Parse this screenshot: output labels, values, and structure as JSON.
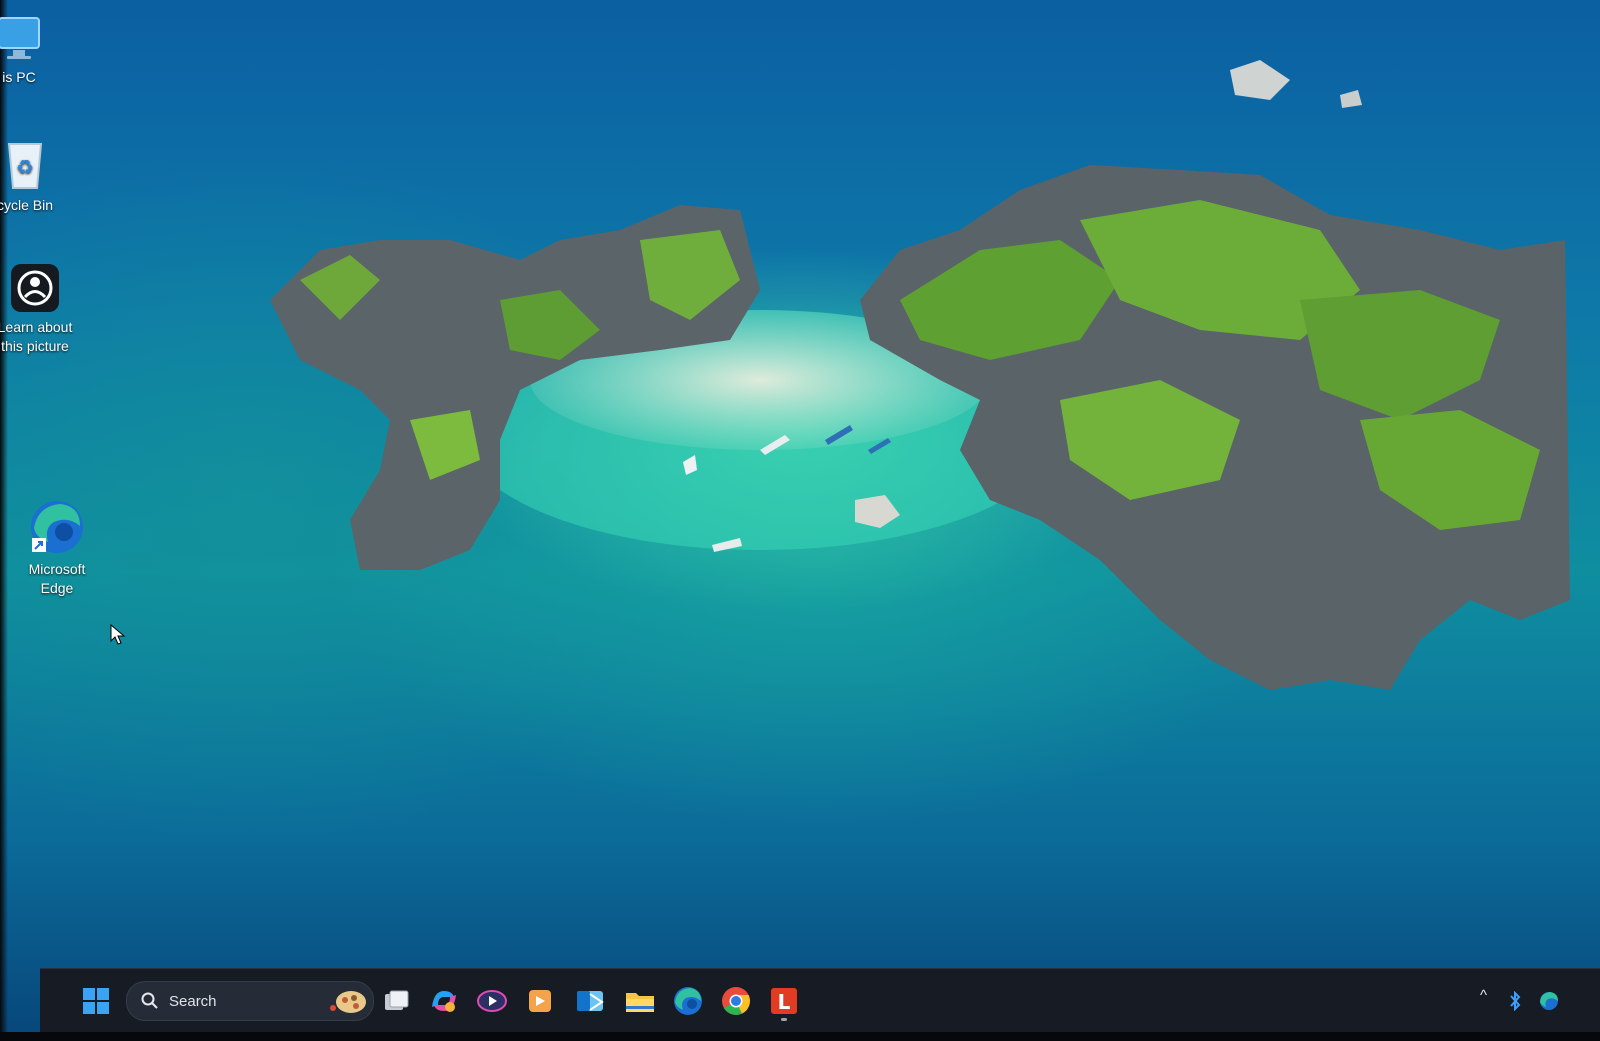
{
  "desktop": {
    "icons": [
      {
        "label": "is PC"
      },
      {
        "label": "cycle Bin"
      },
      {
        "label_line1": "Learn about",
        "label_line2": "this picture"
      },
      {
        "label_line1": "Microsoft",
        "label_line2": "Edge"
      }
    ]
  },
  "taskbar": {
    "search_placeholder": "Search",
    "apps": [
      "Task View",
      "Microsoft 365 Copilot",
      "Media Player",
      "Office",
      "Outlook",
      "File Explorer",
      "Microsoft Edge",
      "Google Chrome",
      "L"
    ],
    "tray": {
      "chevron": "^"
    }
  },
  "colors": {
    "taskbar_bg": "#171c24",
    "windows_blue": "#1e90ff",
    "edge_teal": "#2fc1a0",
    "folder_yellow": "#f6c545",
    "chrome_red": "#e74c3c",
    "l_app_red": "#e23b24"
  }
}
